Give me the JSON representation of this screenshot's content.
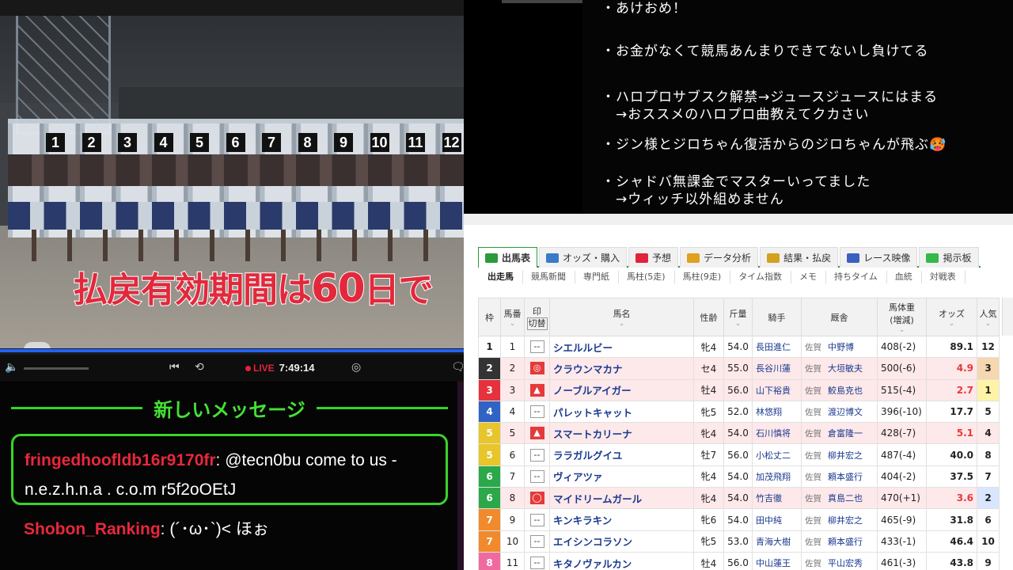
{
  "video": {
    "gate_numbers": [
      "1",
      "2",
      "3",
      "4",
      "5",
      "6",
      "7",
      "8",
      "9",
      "10",
      "11",
      "12"
    ],
    "caption_a": "払戻有効期間は",
    "caption_b": "60",
    "caption_c": "日で"
  },
  "player": {
    "progress": 1.0,
    "live_label": "LIVE",
    "time": "7:49:14",
    "icons": [
      "volume-icon",
      "rewind-icon",
      "replay-icon",
      "record-icon",
      "chat-icon"
    ]
  },
  "chat": {
    "header": "新しいメッセージ",
    "highlight": {
      "user": "fringedhoofldb16r9170fr",
      "sep": ":",
      "text": " @tecn0bu come to us - n.e.z.h.n.a . c.o.m r5f2oOEtJ"
    },
    "message": {
      "user": "Shobon_Ranking",
      "sep": ":",
      "text": " (´･ω･`)< ほぉ"
    }
  },
  "notes": [
    "・あけおめ！",
    "・お金がなくて競馬あんまりできてないし負けてる",
    "・ハロプロサブスク解禁→ジュースジュースにはまる",
    "　→おススメのハロプロ曲教えてクカさい",
    "・ジン様とジロちゃん復活からのジロちゃんが飛ぶ🥵",
    "・シャドバ無課金でマスターいってました",
    "　→ウィッチ以外組めません"
  ],
  "race": {
    "tabs": [
      {
        "label": "出馬表",
        "icon": "table-icon",
        "color": "#2a9a3a"
      },
      {
        "label": "オッズ・購入",
        "icon": "odds-icon",
        "color": "#3a7ac9"
      },
      {
        "label": "予想",
        "icon": "target-icon",
        "color": "#e0243b"
      },
      {
        "label": "データ分析",
        "icon": "chart-icon",
        "color": "#e0a020"
      },
      {
        "label": "結果・払戻",
        "icon": "coins-icon",
        "color": "#d4a020"
      },
      {
        "label": "レース映像",
        "icon": "video-icon",
        "color": "#3a60c0"
      },
      {
        "label": "掲示板",
        "icon": "board-icon",
        "color": "#34b84a"
      }
    ],
    "subtabs": [
      "出走馬",
      "競馬新聞",
      "専門紙",
      "馬柱(5走)",
      "馬柱(9走)",
      "タイム指数",
      "メモ",
      "持ちタイム",
      "血統",
      "対戦表"
    ],
    "headers": {
      "waku": "枠",
      "umaban": "馬番",
      "mark": "印",
      "mark_toggle": "切替",
      "name": "馬名",
      "sexage": "性齢",
      "weight": "斤量",
      "jockey": "騎手",
      "trainer": "厩舎",
      "body": "馬体重",
      "body_sub": "(増減)",
      "odds": "オッズ",
      "pop": "人気",
      "sort_marker": "⌄"
    },
    "rows": [
      {
        "waku": "1",
        "umaban": "1",
        "mark": "--",
        "name": "シエルルビー",
        "sexage": "牝4",
        "weight": "54.0",
        "jockey": "長田進仁",
        "loc": "佐賀",
        "trainer": "中野博",
        "body": "408(-2)",
        "odds": "89.1",
        "pop": "12",
        "waku_color": "#ffffff",
        "waku_text": "#222222"
      },
      {
        "waku": "2",
        "umaban": "2",
        "mark": "◎",
        "name": "クラウンマカナ",
        "sexage": "セ4",
        "weight": "55.0",
        "jockey": "長谷川蓮",
        "loc": "佐賀",
        "trainer": "大垣敏夫",
        "body": "500(-6)",
        "odds": "4.9",
        "pop": "3",
        "waku_color": "#333333",
        "waku_text": "#ffffff",
        "hl": true
      },
      {
        "waku": "3",
        "umaban": "3",
        "mark": "▲",
        "name": "ノーブルアイガー",
        "sexage": "牡4",
        "weight": "56.0",
        "jockey": "山下裕貴",
        "loc": "佐賀",
        "trainer": "鮫島克也",
        "body": "515(-4)",
        "odds": "2.7",
        "pop": "1",
        "waku_color": "#e5323d",
        "waku_text": "#ffffff",
        "hl": true
      },
      {
        "waku": "4",
        "umaban": "4",
        "mark": "--",
        "name": "パレットキャット",
        "sexage": "牝5",
        "weight": "52.0",
        "jockey": "林悠翔",
        "loc": "佐賀",
        "trainer": "渡辺博文",
        "body": "396(-10)",
        "odds": "17.7",
        "pop": "5",
        "waku_color": "#2f63c4",
        "waku_text": "#ffffff"
      },
      {
        "waku": "5",
        "umaban": "5",
        "mark": "▲",
        "name": "スマートカリーナ",
        "sexage": "牝4",
        "weight": "54.0",
        "jockey": "石川慎将",
        "loc": "佐賀",
        "trainer": "倉富隆一",
        "body": "428(-7)",
        "odds": "5.1",
        "pop": "4",
        "waku_color": "#e8c52a",
        "waku_text": "#ffffff",
        "hl": true
      },
      {
        "waku": "5",
        "umaban": "6",
        "mark": "--",
        "name": "ララガルグイユ",
        "sexage": "牡7",
        "weight": "56.0",
        "jockey": "小松丈二",
        "loc": "佐賀",
        "trainer": "柳井宏之",
        "body": "487(-4)",
        "odds": "40.0",
        "pop": "8",
        "waku_color": "#e8c52a",
        "waku_text": "#ffffff"
      },
      {
        "waku": "6",
        "umaban": "7",
        "mark": "--",
        "name": "ヴィアツァ",
        "sexage": "牝4",
        "weight": "54.0",
        "jockey": "加茂飛翔",
        "loc": "佐賀",
        "trainer": "頼本盛行",
        "body": "404(-2)",
        "odds": "37.5",
        "pop": "7",
        "waku_color": "#2aa84a",
        "waku_text": "#ffffff"
      },
      {
        "waku": "6",
        "umaban": "8",
        "mark": "◯",
        "name": "マイドリームガール",
        "sexage": "牝4",
        "weight": "54.0",
        "jockey": "竹吉徹",
        "loc": "佐賀",
        "trainer": "真島二也",
        "body": "470(+1)",
        "odds": "3.6",
        "pop": "2",
        "waku_color": "#2aa84a",
        "waku_text": "#ffffff",
        "hl": true
      },
      {
        "waku": "7",
        "umaban": "9",
        "mark": "--",
        "name": "キンキラキン",
        "sexage": "牝6",
        "weight": "54.0",
        "jockey": "田中純",
        "loc": "佐賀",
        "trainer": "柳井宏之",
        "body": "465(-9)",
        "odds": "31.8",
        "pop": "6",
        "waku_color": "#f08a2c",
        "waku_text": "#ffffff"
      },
      {
        "waku": "7",
        "umaban": "10",
        "mark": "--",
        "name": "エイシンコラソン",
        "sexage": "牝5",
        "weight": "53.0",
        "jockey": "青海大樹",
        "loc": "佐賀",
        "trainer": "頼本盛行",
        "body": "433(-1)",
        "odds": "46.4",
        "pop": "10",
        "waku_color": "#f08a2c",
        "waku_text": "#ffffff"
      },
      {
        "waku": "8",
        "umaban": "11",
        "mark": "--",
        "name": "キタノヴァルカン",
        "sexage": "牡4",
        "weight": "56.0",
        "jockey": "中山蓮王",
        "loc": "佐賀",
        "trainer": "平山宏秀",
        "body": "461(-3)",
        "odds": "43.8",
        "pop": "9",
        "waku_color": "#f06aa0",
        "waku_text": "#ffffff"
      }
    ]
  }
}
